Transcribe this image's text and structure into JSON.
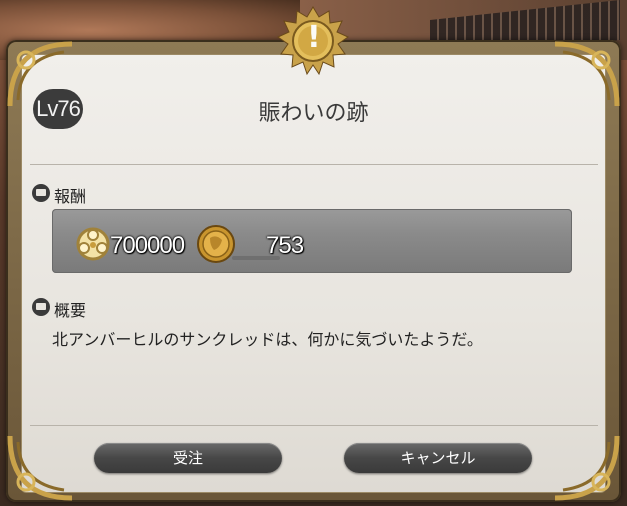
{
  "dialog": {
    "level": "Lv76",
    "title": "賑わいの跡"
  },
  "rewards": {
    "heading": "報酬",
    "gil": "700000",
    "seals": "753"
  },
  "summary": {
    "heading": "概要",
    "text": "北アンバーヒルのサンクレッドは、何かに気づいたようだ。"
  },
  "buttons": {
    "accept": "受注",
    "cancel": "キャンセル"
  },
  "colors": {
    "panel": "#ebe8e2",
    "frame_gold": "#c9a24a",
    "button_dark": "#474747"
  },
  "icons": {
    "top": "exclamation-medallion-icon",
    "reward": "reward-section-icon",
    "summary": "book-icon",
    "gil": "gil-icon",
    "seal": "seal-coin-icon"
  }
}
